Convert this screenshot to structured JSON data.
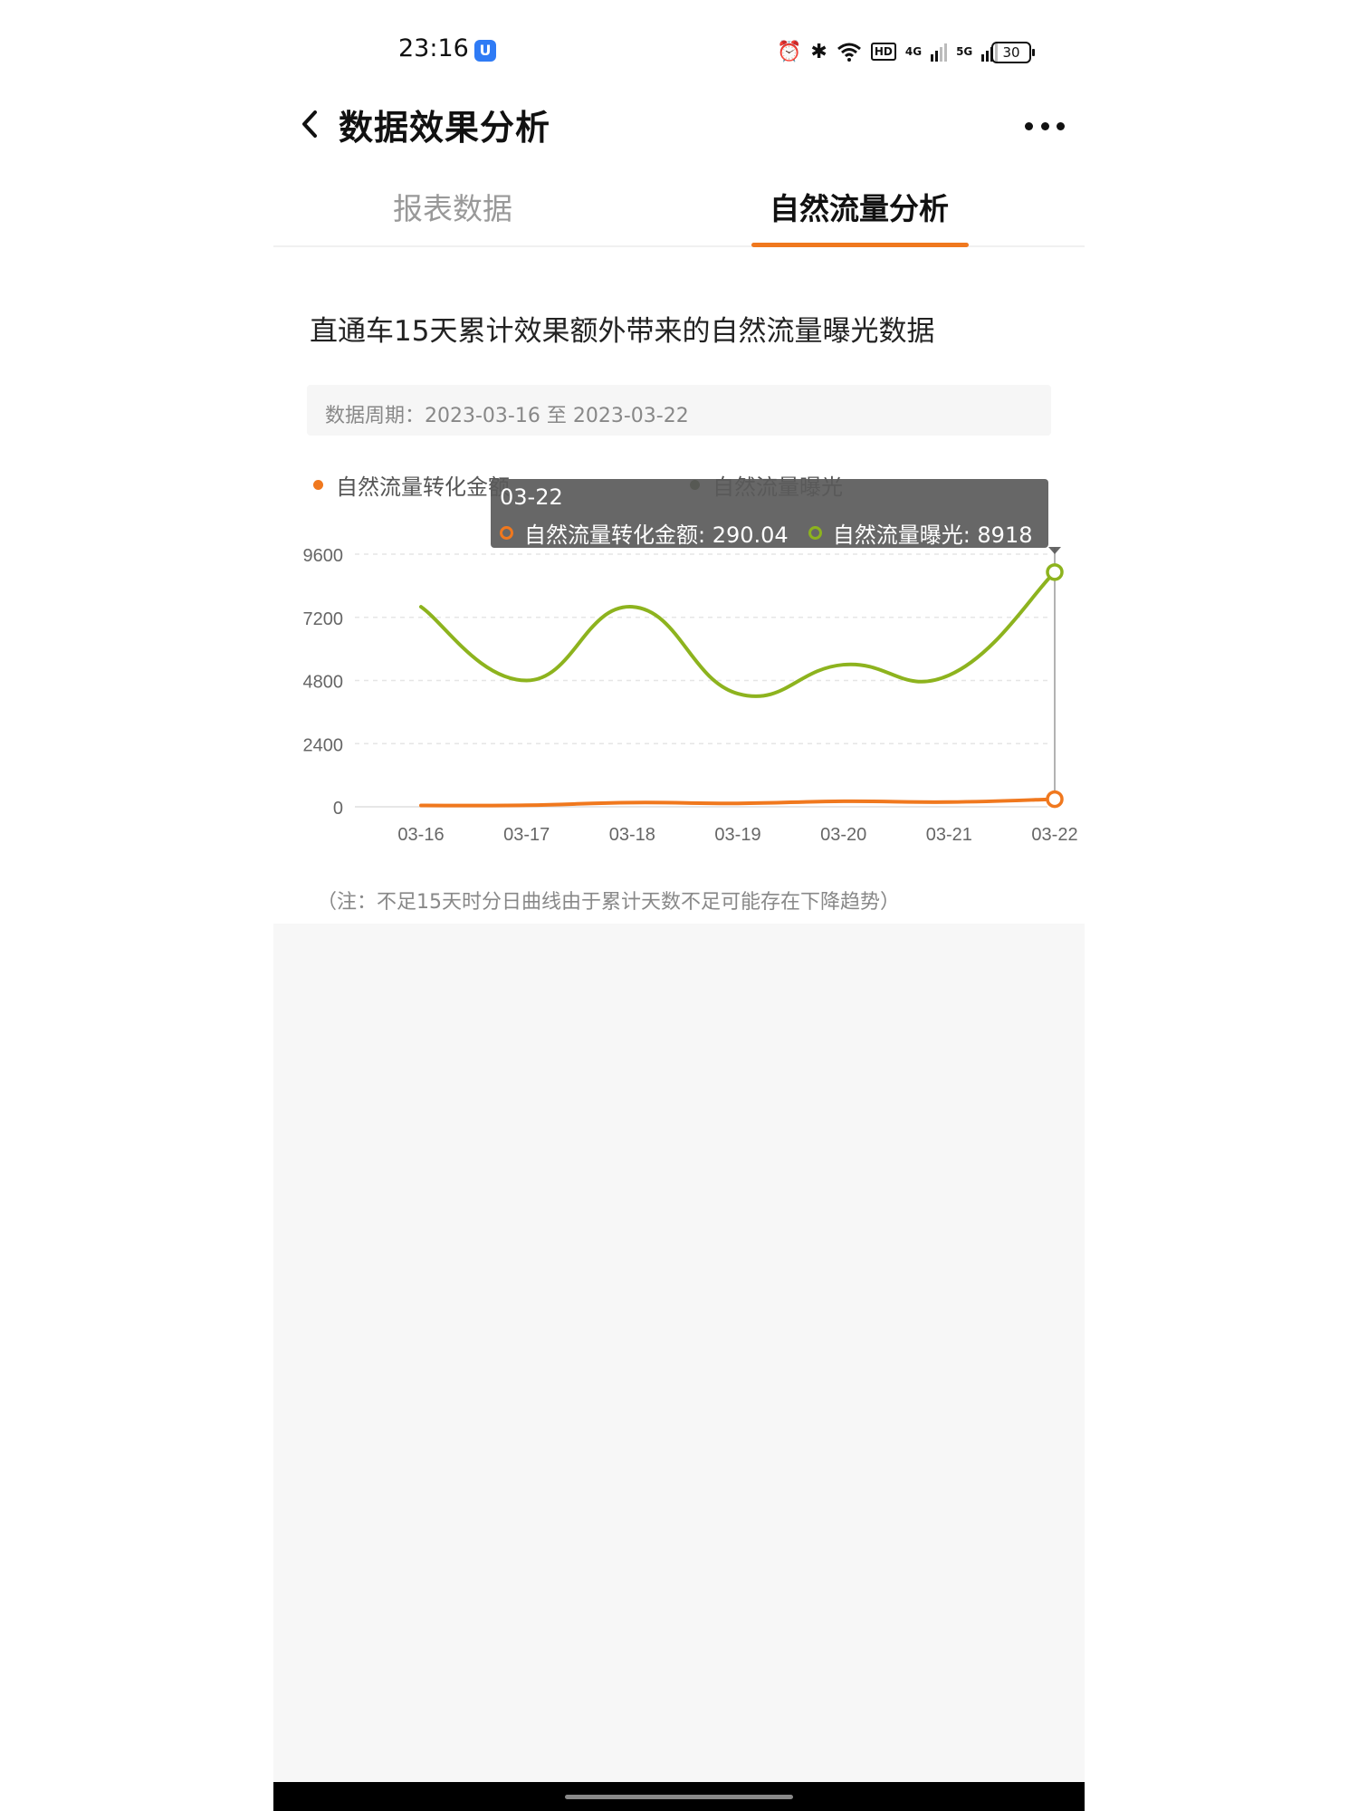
{
  "status_bar": {
    "time": "23:16",
    "app_badge": "U",
    "net_4g": "4G",
    "net_5g": "5G",
    "hd": "HD",
    "battery": "30"
  },
  "nav": {
    "title": "数据效果分析"
  },
  "tabs": [
    {
      "label": "报表数据",
      "active": false
    },
    {
      "label": "自然流量分析",
      "active": true
    }
  ],
  "section": {
    "title": "直通车15天累计效果额外带来的自然流量曝光数据",
    "period": "数据周期：2023-03-16 至 2023-03-22"
  },
  "tooltip": {
    "date": "03-22",
    "series1_label": "自然流量转化金额: 290.04",
    "series2_label": "自然流量曝光: 8918"
  },
  "note": "（注：不足15天时分日曲线由于累计天数不足可能存在下降趋势）",
  "colors": {
    "accent": "#f0781e",
    "series1": "#f0781e",
    "series2": "#8db31e"
  },
  "chart_data": {
    "type": "line",
    "x": [
      "03-16",
      "03-17",
      "03-18",
      "03-19",
      "03-20",
      "03-21",
      "03-22"
    ],
    "yticks": [
      0,
      2400,
      4800,
      7200,
      9600
    ],
    "ylim": [
      0,
      9600
    ],
    "series": [
      {
        "name": "自然流量转化金额",
        "color": "#f0781e",
        "values": [
          50,
          60,
          160,
          130,
          210,
          180,
          290.04
        ]
      },
      {
        "name": "自然流量曝光",
        "color": "#8db31e",
        "values": [
          7600,
          4800,
          7600,
          4300,
          5400,
          5000,
          8918
        ]
      }
    ],
    "highlight_index": 6,
    "grid": true,
    "legend": "top"
  }
}
